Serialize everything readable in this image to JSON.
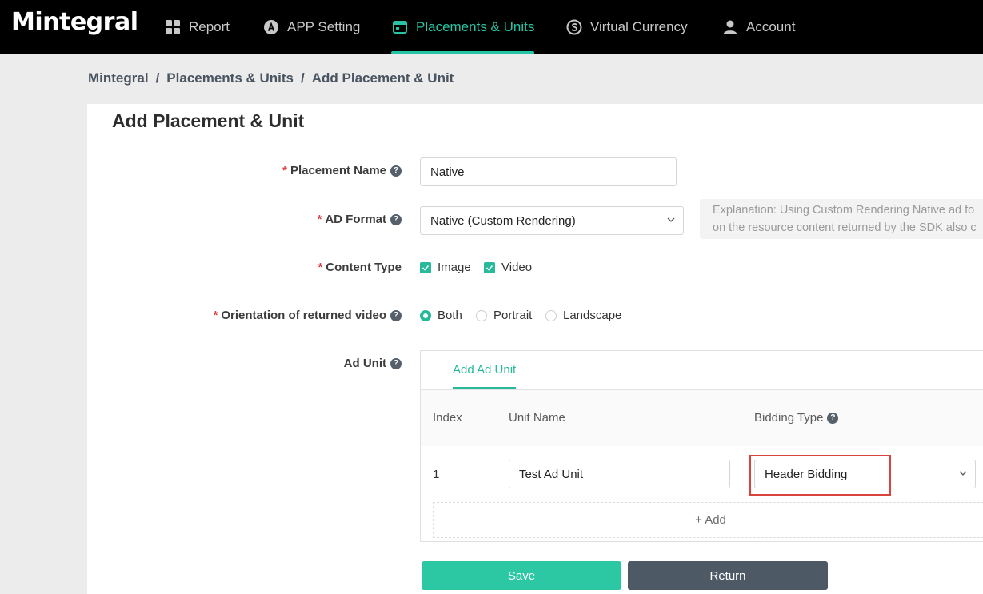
{
  "brand": {
    "logo": "Mintegral",
    "accent": "#26b99a",
    "danger": "#d9433c"
  },
  "nav": [
    {
      "label": "Report",
      "icon": "grid-icon"
    },
    {
      "label": "APP Setting",
      "icon": "app-store-icon"
    },
    {
      "label": "Placements & Units",
      "icon": "calendar-icon",
      "active": true
    },
    {
      "label": "Virtual Currency",
      "icon": "currency-icon"
    },
    {
      "label": "Account",
      "icon": "user-icon"
    }
  ],
  "breadcrumb": [
    "Mintegral",
    "Placements & Units",
    "Add Placement & Unit"
  ],
  "page_title": "Add Placement & Unit",
  "form": {
    "placement_name": {
      "label": "Placement Name",
      "value": "Native"
    },
    "ad_format": {
      "label": "AD Format",
      "value": "Native (Custom Rendering)",
      "explanation_line1": "Explanation: Using Custom Rendering Native ad fo",
      "explanation_line2": "on the resource content returned by the SDK also c"
    },
    "content_type": {
      "label": "Content Type",
      "options": [
        "Image",
        "Video"
      ],
      "checked": [
        "Image",
        "Video"
      ]
    },
    "orientation": {
      "label": "Orientation of returned video",
      "options": [
        "Both",
        "Portrait",
        "Landscape"
      ],
      "selected": "Both"
    },
    "ad_unit": {
      "label": "Ad Unit",
      "tab": "Add Ad Unit",
      "columns": [
        "Index",
        "Unit Name",
        "Bidding Type"
      ],
      "rows": [
        {
          "index": "1",
          "unit_name": "Test Ad Unit",
          "bidding_type": "Header Bidding"
        }
      ],
      "add_label": "+ Add"
    }
  },
  "buttons": {
    "save": "Save",
    "return": "Return"
  }
}
